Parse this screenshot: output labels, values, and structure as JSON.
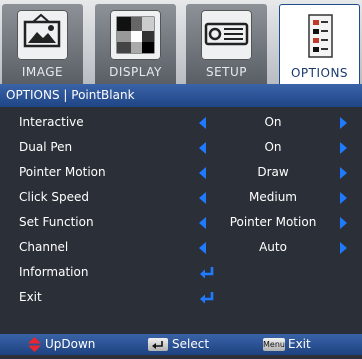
{
  "tabs": [
    {
      "label": "IMAGE",
      "icon": "image-icon",
      "active": false
    },
    {
      "label": "DISPLAY",
      "icon": "display-icon",
      "active": false
    },
    {
      "label": "SETUP",
      "icon": "projector-icon",
      "active": false
    },
    {
      "label": "OPTIONS",
      "icon": "options-icon",
      "active": true
    }
  ],
  "title": "OPTIONS | PointBlank",
  "rows": [
    {
      "label": "Interactive",
      "value": "On"
    },
    {
      "label": "Dual Pen",
      "value": "On"
    },
    {
      "label": "Pointer Motion",
      "value": "Draw"
    },
    {
      "label": "Click Speed",
      "value": "Medium"
    },
    {
      "label": "Set Function",
      "value": "Pointer Motion"
    },
    {
      "label": "Channel",
      "value": "Auto"
    },
    {
      "label": "Information",
      "value": null
    },
    {
      "label": "Exit",
      "value": null
    }
  ],
  "footer": {
    "updown_label": "UpDown",
    "select_label": "Select",
    "menu_key_label": "Menu",
    "exit_label": "Exit"
  },
  "colors": {
    "accent": "#1e7bff",
    "titlebar": "#2a55a0",
    "background": "#2b3038",
    "updown_arrow": "#e8262f"
  }
}
